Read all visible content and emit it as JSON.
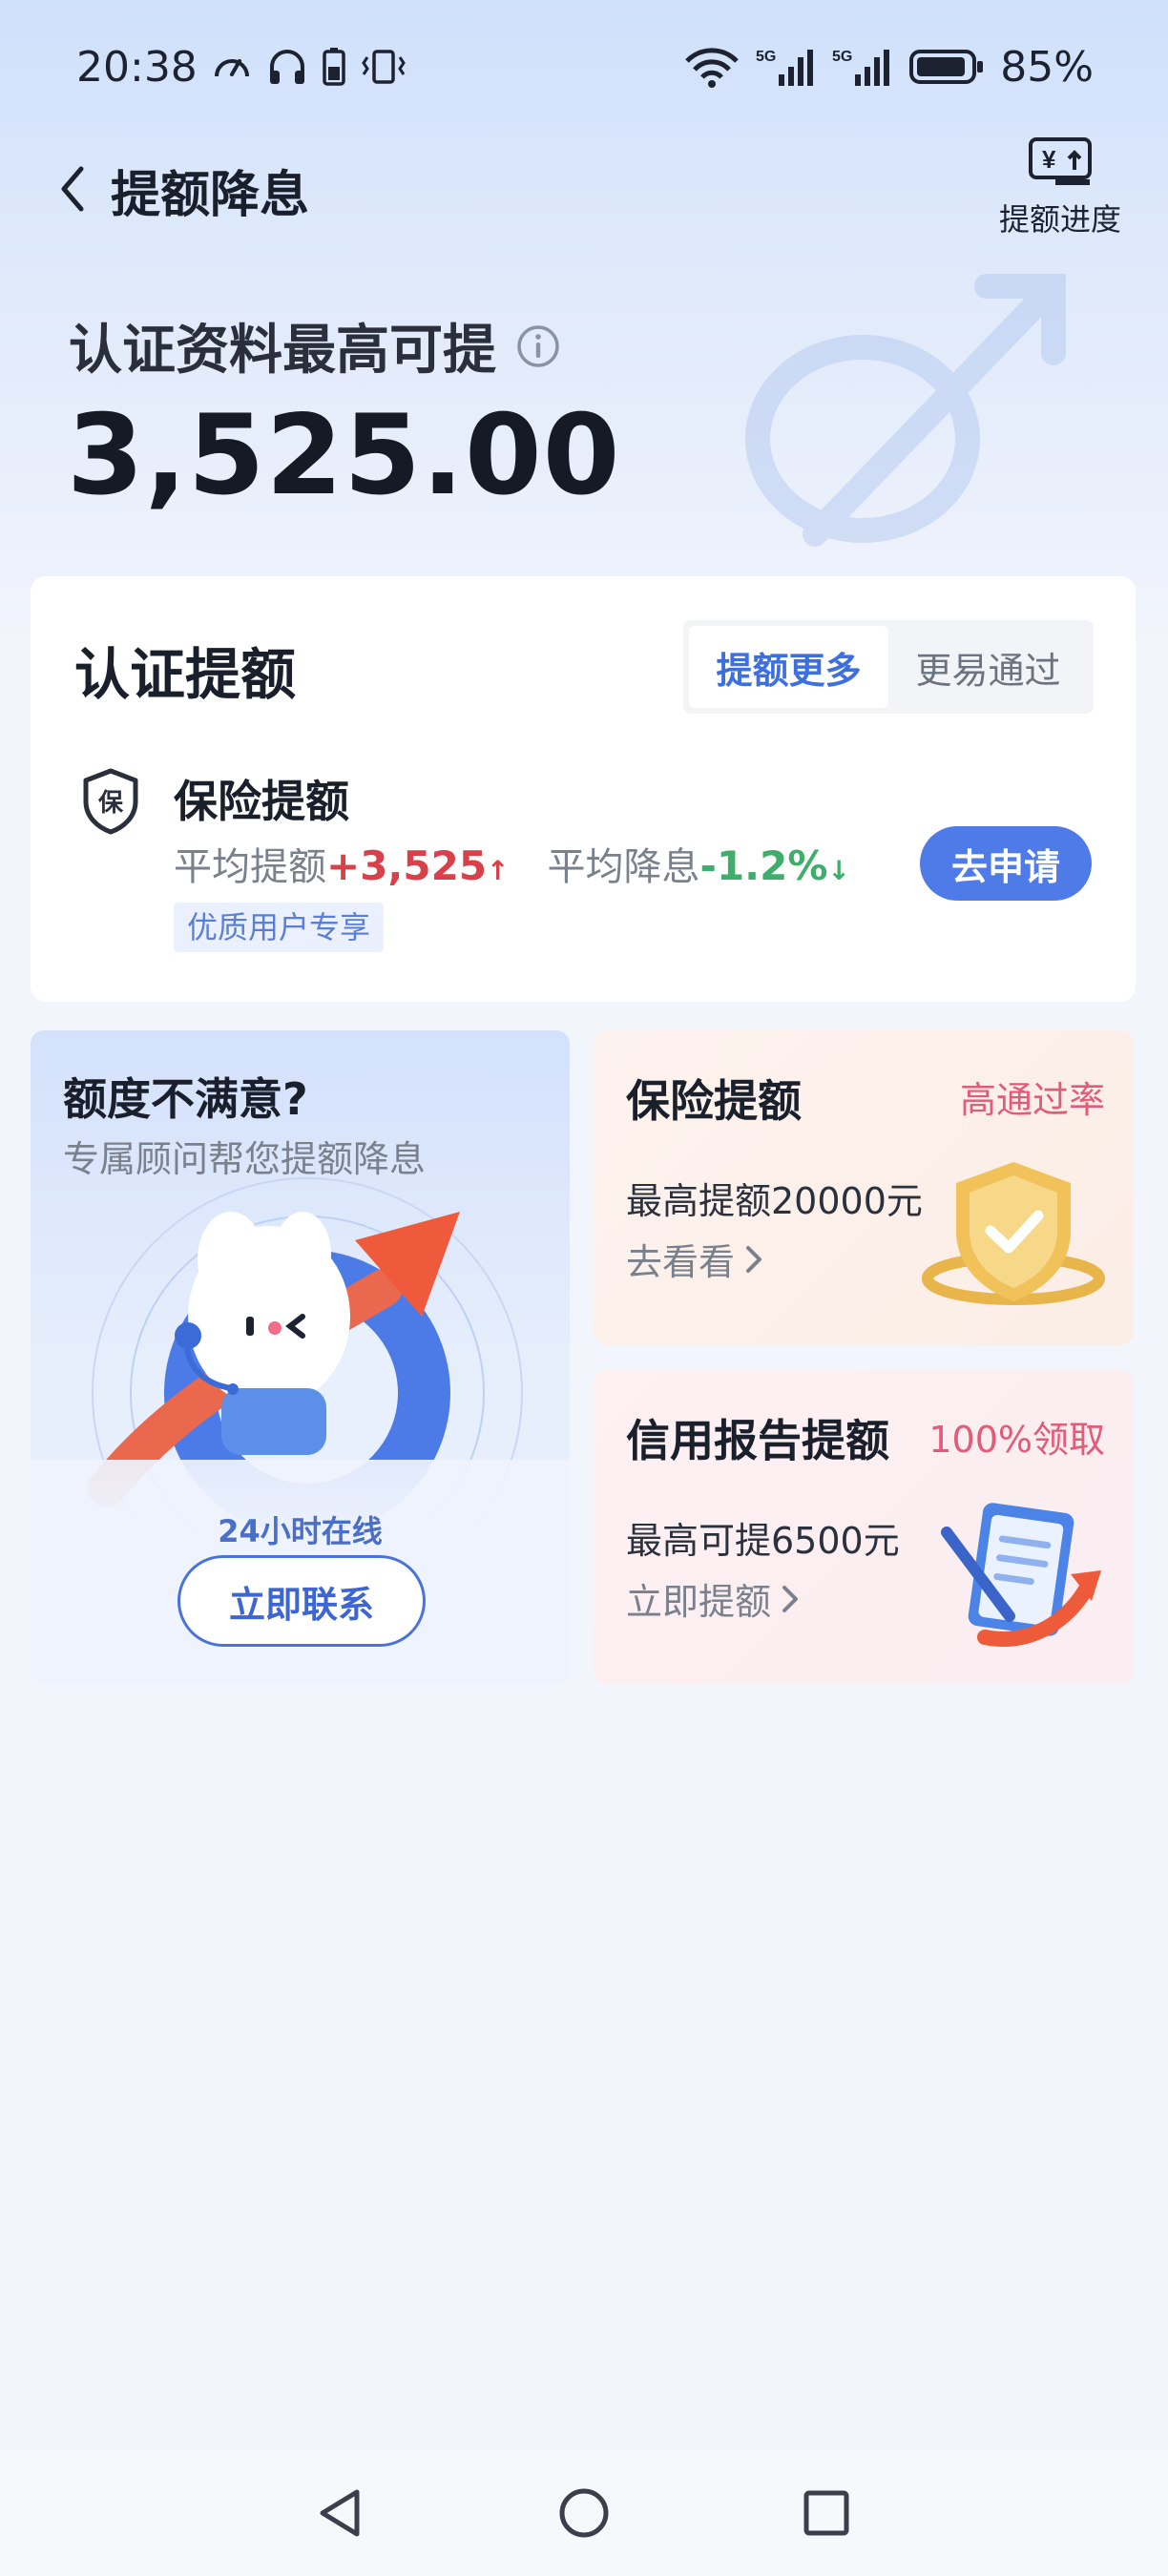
{
  "status": {
    "time": "20:38",
    "battery": "85%"
  },
  "nav": {
    "title": "提额降息",
    "progress_label": "提额进度",
    "progress_icon": "yuan-up-icon"
  },
  "amount": {
    "label": "认证资料最高可提",
    "value": "3,525.00"
  },
  "cert": {
    "title": "认证提额",
    "tabs": [
      {
        "label": "提额更多",
        "active": true
      },
      {
        "label": "更易通过",
        "active": false
      }
    ],
    "item": {
      "badge_char": "保",
      "name": "保险提额",
      "avg_raise_label": "平均提额",
      "avg_raise_value": "+3,525",
      "avg_raise_arrow": "↑",
      "avg_cut_label": "平均降息",
      "avg_cut_value": "-1.2%",
      "avg_cut_arrow": "↓",
      "tag": "优质用户专享",
      "button": "去申请"
    }
  },
  "advisor": {
    "title": "额度不满意?",
    "subtitle": "专属顾问帮您提额降息",
    "online": "24小时在线",
    "button": "立即联系"
  },
  "promos": [
    {
      "title": "保险提额",
      "tag": "高通过率",
      "desc": "最高提额20000元",
      "link": "去看看"
    },
    {
      "title": "信用报告提额",
      "tag": "100%领取",
      "desc": "最高可提6500元",
      "link": "立即提额"
    }
  ],
  "colors": {
    "accent": "#4f7be9",
    "up": "#d8404a",
    "down": "#3fae6b",
    "tag_pink": "#e25b78"
  }
}
